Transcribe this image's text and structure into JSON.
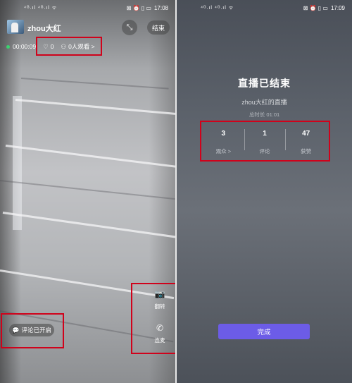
{
  "left": {
    "status_bar": {
      "signal": "⁴ᴳ.ıl ⁴ᴳ.ıl ᯤ",
      "time": "17:08"
    },
    "user": {
      "name": "zhou大红"
    },
    "buttons": {
      "end": "结束"
    },
    "live": {
      "elapsed": "00:00:09",
      "likes": "0",
      "viewers": "0人观看 >"
    },
    "comment": {
      "label": "评论已开启"
    },
    "side": {
      "flip": "翻转",
      "call": "连麦"
    }
  },
  "right": {
    "status_bar": {
      "signal": "⁴ᴳ.ıl ⁴ᴳ.ıl ᯤ",
      "time": "17:09"
    },
    "title": "直播已结束",
    "subtitle": "zhou大红的直播",
    "duration": "总时长 01:01",
    "stats": [
      {
        "value": "3",
        "label": "观众 >"
      },
      {
        "value": "1",
        "label": "评论"
      },
      {
        "value": "47",
        "label": "获赞"
      }
    ],
    "done": "完成"
  },
  "colors": {
    "highlight": "#d0021b",
    "primary": "#6c5ce7",
    "live_dot": "#3bd16f"
  },
  "icons": [
    "compress-icon",
    "heart-icon",
    "person-icon",
    "chat-bubble-icon",
    "camera-flip-icon",
    "phone-icon"
  ]
}
